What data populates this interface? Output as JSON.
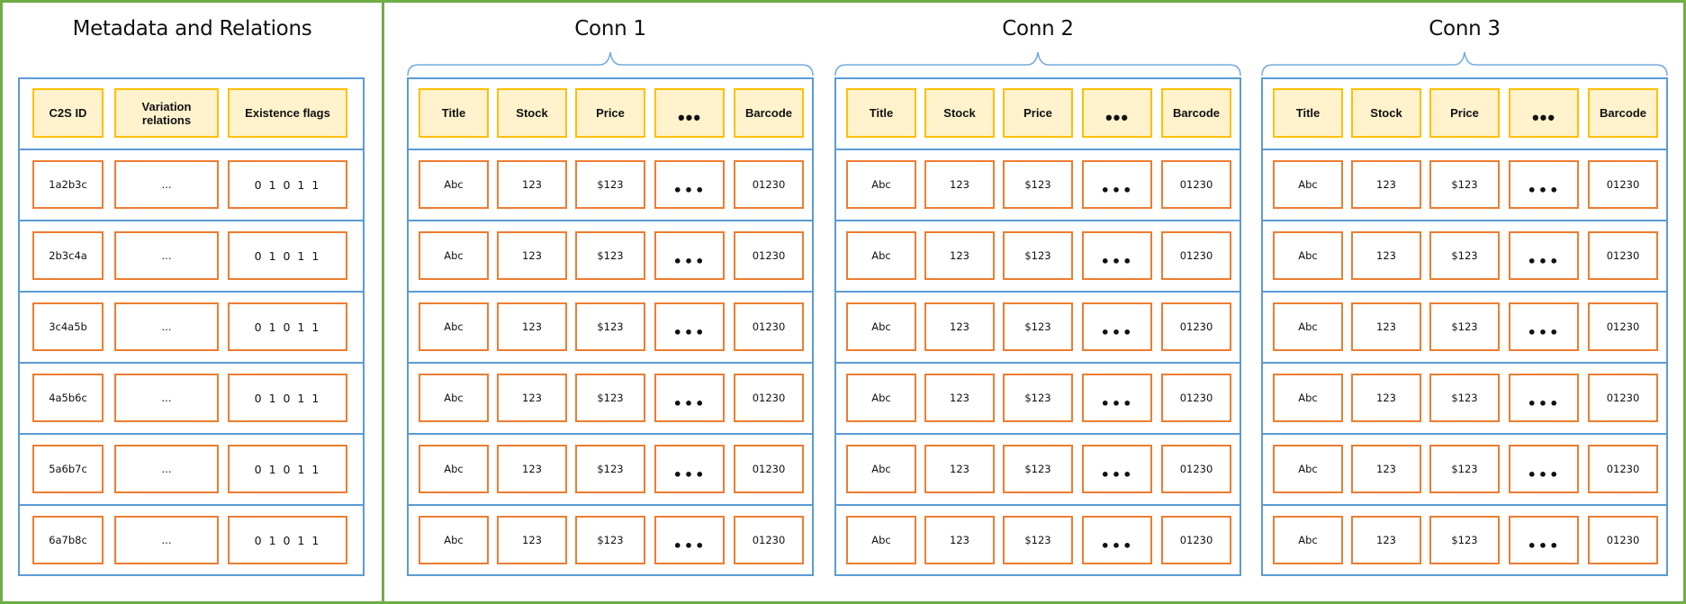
{
  "colors": {
    "panel_border": "#70ad47",
    "table_border": "#5b9bd5",
    "header_border": "#ffc000",
    "header_fill": "#fff2cc",
    "data_border": "#ed7d31"
  },
  "metadata": {
    "title": "Metadata and Relations",
    "headers": [
      "C2S ID",
      "Variation relations",
      "Existence flags"
    ],
    "rows": [
      {
        "id": "1a2b3c",
        "relations": "...",
        "flags": "0 1 0 1 1"
      },
      {
        "id": "2b3c4a",
        "relations": "...",
        "flags": "0 1 0 1 1"
      },
      {
        "id": "3c4a5b",
        "relations": "...",
        "flags": "0 1 0 1 1"
      },
      {
        "id": "4a5b6c",
        "relations": "...",
        "flags": "0 1 0 1 1"
      },
      {
        "id": "5a6b7c",
        "relations": "...",
        "flags": "0 1 0 1 1"
      },
      {
        "id": "6a7b8c",
        "relations": "...",
        "flags": "0 1 0 1 1"
      }
    ]
  },
  "connections": [
    {
      "title": "Conn 1",
      "headers": [
        "Title",
        "Stock",
        "Price",
        "•••",
        "Barcode"
      ],
      "rows": [
        [
          "Abc",
          "123",
          "$123",
          "•••",
          "01230"
        ],
        [
          "Abc",
          "123",
          "$123",
          "•••",
          "01230"
        ],
        [
          "Abc",
          "123",
          "$123",
          "•••",
          "01230"
        ],
        [
          "Abc",
          "123",
          "$123",
          "•••",
          "01230"
        ],
        [
          "Abc",
          "123",
          "$123",
          "•••",
          "01230"
        ],
        [
          "Abc",
          "123",
          "$123",
          "•••",
          "01230"
        ]
      ]
    },
    {
      "title": "Conn 2",
      "headers": [
        "Title",
        "Stock",
        "Price",
        "•••",
        "Barcode"
      ],
      "rows": [
        [
          "Abc",
          "123",
          "$123",
          "•••",
          "01230"
        ],
        [
          "Abc",
          "123",
          "$123",
          "•••",
          "01230"
        ],
        [
          "Abc",
          "123",
          "$123",
          "•••",
          "01230"
        ],
        [
          "Abc",
          "123",
          "$123",
          "•••",
          "01230"
        ],
        [
          "Abc",
          "123",
          "$123",
          "•••",
          "01230"
        ],
        [
          "Abc",
          "123",
          "$123",
          "•••",
          "01230"
        ]
      ]
    },
    {
      "title": "Conn 3",
      "headers": [
        "Title",
        "Stock",
        "Price",
        "•••",
        "Barcode"
      ],
      "rows": [
        [
          "Abc",
          "123",
          "$123",
          "•••",
          "01230"
        ],
        [
          "Abc",
          "123",
          "$123",
          "•••",
          "01230"
        ],
        [
          "Abc",
          "123",
          "$123",
          "•••",
          "01230"
        ],
        [
          "Abc",
          "123",
          "$123",
          "•••",
          "01230"
        ],
        [
          "Abc",
          "123",
          "$123",
          "•••",
          "01230"
        ],
        [
          "Abc",
          "123",
          "$123",
          "•••",
          "01230"
        ]
      ]
    }
  ]
}
